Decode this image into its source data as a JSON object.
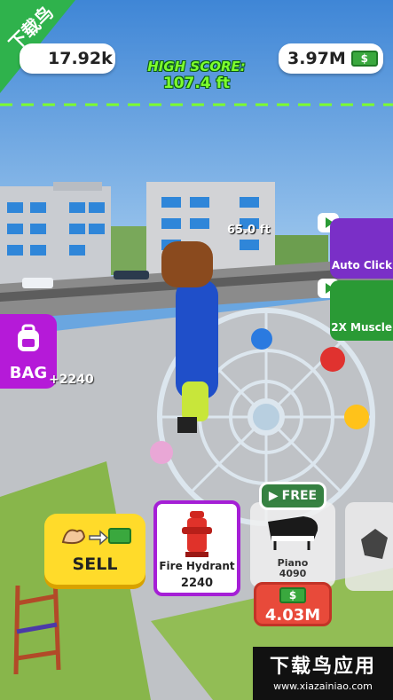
{
  "hud": {
    "strength": "17.92k",
    "cash": "3.97M",
    "high_score_label": "HIGH SCORE:",
    "high_score_value": "107.4 ft",
    "distance": "65.0 ft"
  },
  "bag": {
    "label": "BAG",
    "count": "+2240"
  },
  "side_buttons": {
    "auto_click": "Auto Click",
    "muscle_2x": "2X Muscle"
  },
  "sell": {
    "label": "SELL"
  },
  "items": [
    {
      "name": "Fire Hydrant",
      "value": "2240"
    },
    {
      "name": "Piano",
      "value": "4090",
      "price": "4.03M",
      "free_label": "FREE"
    }
  ],
  "watermark": {
    "corner": "下载鸟",
    "brand": "下载鸟应用",
    "url": "www.xiazainiao.com"
  },
  "colors": {
    "bag": "#b51ad8",
    "sell": "#ffdb2a",
    "price": "#e84a3a",
    "high_score": "#7dff2e"
  }
}
